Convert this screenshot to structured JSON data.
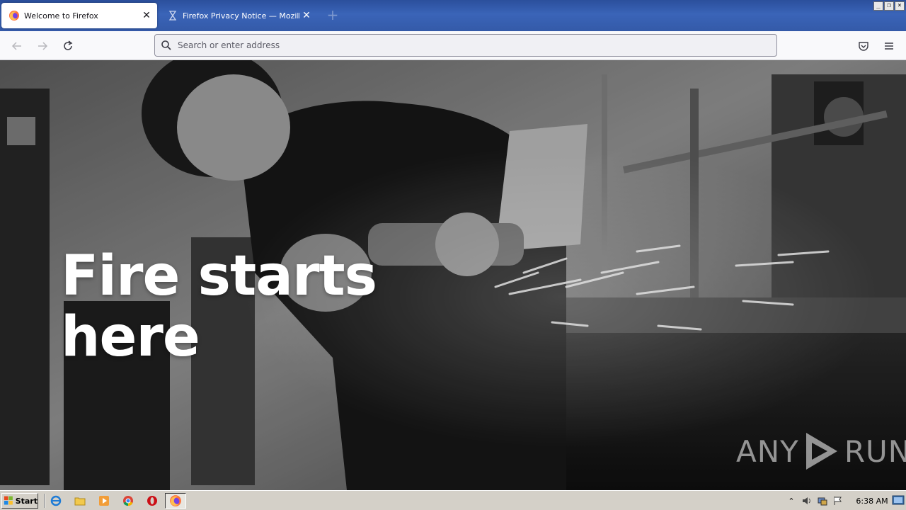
{
  "browser": {
    "tabs": [
      {
        "title": "Welcome to Firefox",
        "active": true,
        "favicon": "firefox-icon"
      },
      {
        "title": "Firefox Privacy Notice — Mozilla",
        "active": false,
        "favicon": "hourglass-icon"
      }
    ],
    "new_tab_icon": "plus-icon",
    "window_controls": {
      "minimize": "_",
      "restore": "❐",
      "close": "×"
    },
    "nav": {
      "back_icon": "back-arrow-icon",
      "forward_icon": "forward-arrow-icon",
      "reload_icon": "reload-icon",
      "search_placeholder": "Search or enter address",
      "pocket_icon": "pocket-icon",
      "menu_icon": "hamburger-menu-icon"
    }
  },
  "page": {
    "hero_title": "Fire starts\nhere",
    "watermark": {
      "left": "ANY",
      "right": "RUN"
    }
  },
  "taskbar": {
    "start_label": "Start",
    "quick_launch": [
      "internet-explorer-icon",
      "folder-icon",
      "media-player-icon",
      "chrome-icon",
      "opera-icon"
    ],
    "running": [
      "firefox-icon"
    ],
    "tray": [
      "chevron-up-icon",
      "speaker-icon",
      "network-icon",
      "flag-icon"
    ],
    "clock": "6:38 AM"
  },
  "colors": {
    "tabstrip": "#345aa8",
    "navbar": "#f9f9fb",
    "urlbar": "#f0f0f4",
    "taskbar": "#d4d0c8"
  }
}
